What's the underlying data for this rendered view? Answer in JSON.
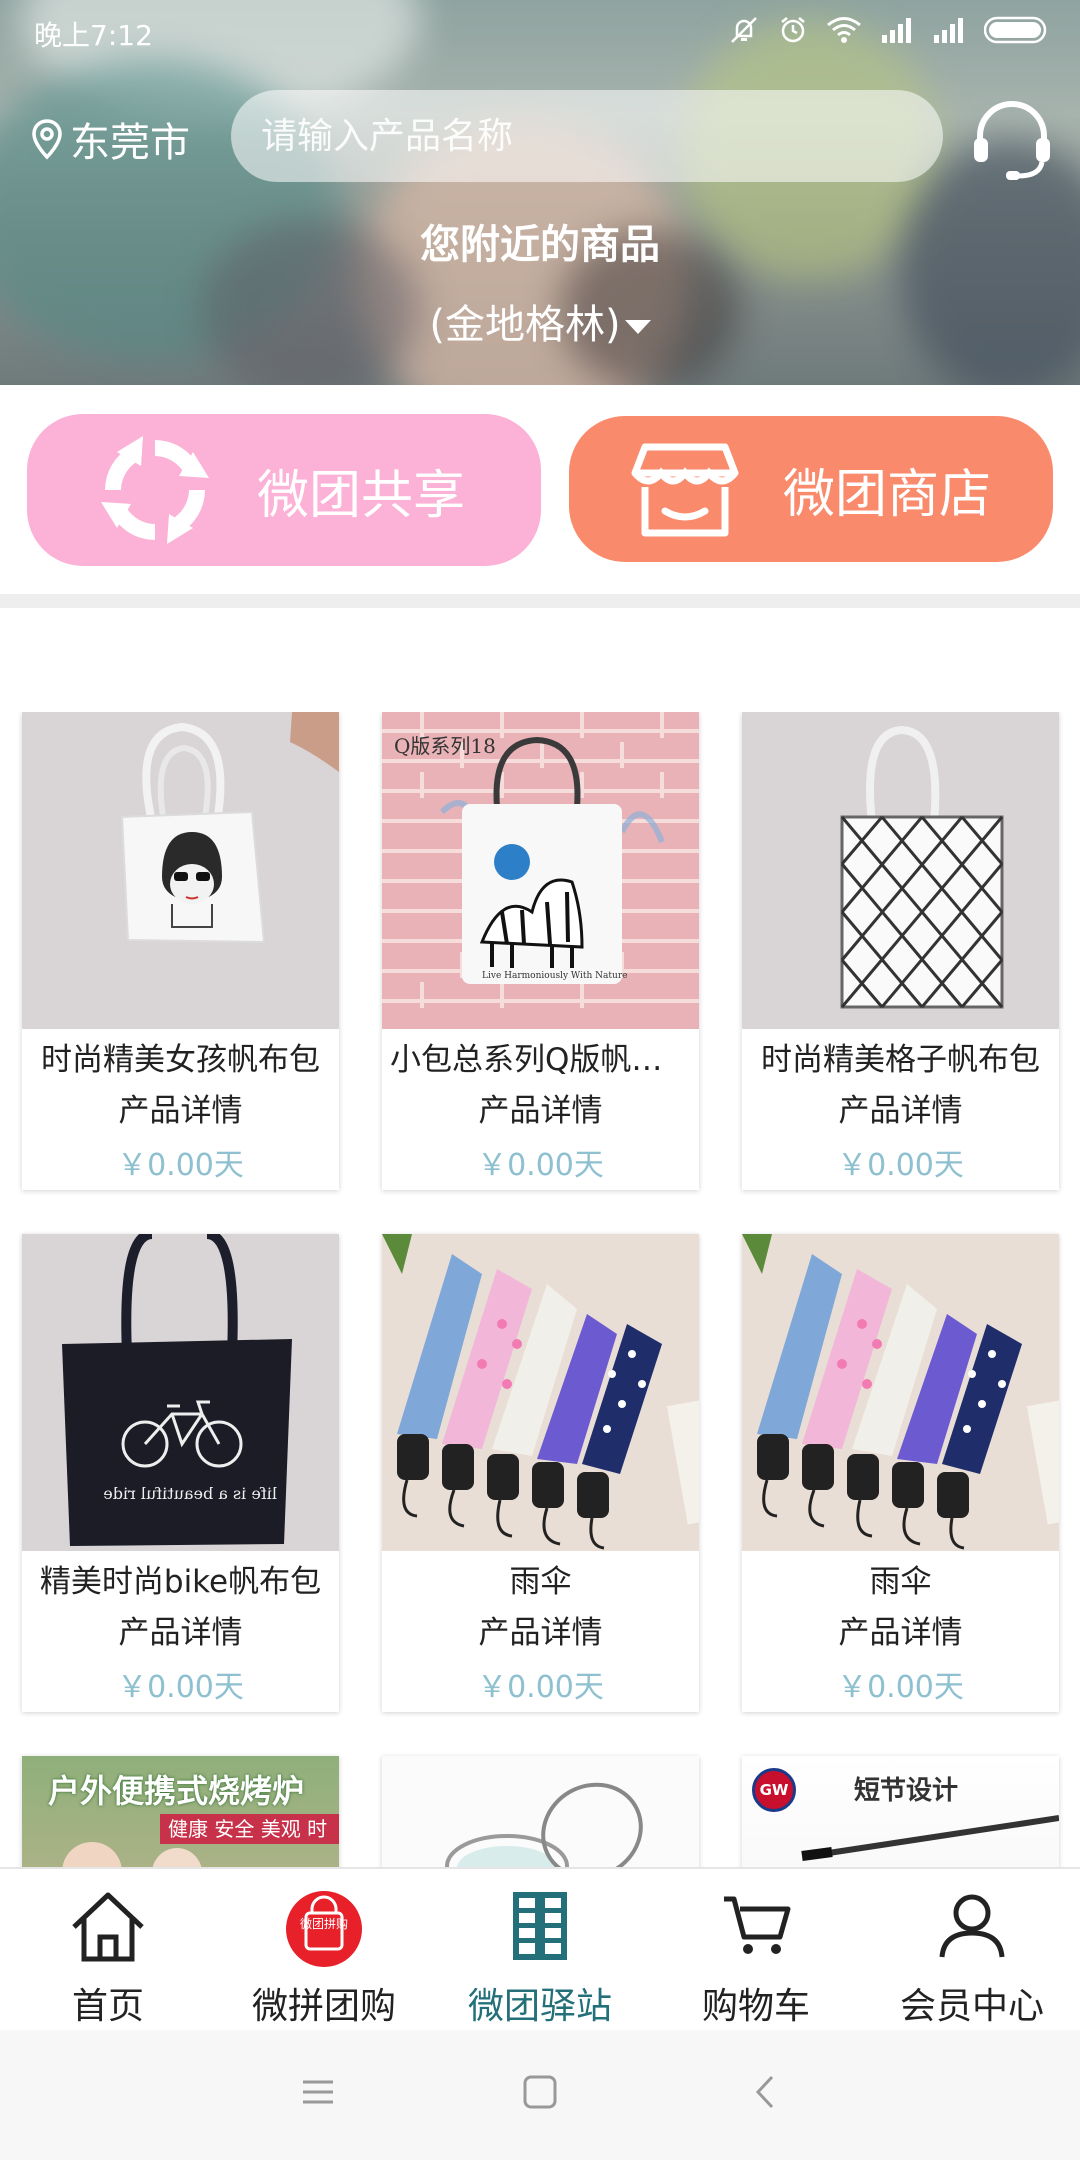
{
  "status": {
    "time": "晚上7:12"
  },
  "header": {
    "location": "东莞市",
    "search_placeholder": "请输入产品名称",
    "title": "您附近的商品",
    "subtitle": "(金地格林)"
  },
  "shortcuts": {
    "share_label": "微团共享",
    "store_label": "微团商店"
  },
  "products": [
    {
      "name": "时尚精美女孩帆布包",
      "detail": "产品详情",
      "price": "￥0.00天",
      "image": "tote-girl"
    },
    {
      "name": "小包总系列Q版帆布包",
      "detail": "产品详情",
      "price": "￥0.00天",
      "image": "tote-zebra",
      "badge": "Q版系列18"
    },
    {
      "name": "时尚精美格子帆布包",
      "detail": "产品详情",
      "price": "￥0.00天",
      "image": "tote-grid"
    },
    {
      "name": "精美时尚bike帆布包",
      "detail": "产品详情",
      "price": "￥0.00天",
      "image": "tote-bike"
    },
    {
      "name": "雨伞",
      "detail": "产品详情",
      "price": "￥0.00天",
      "image": "umbrellas"
    },
    {
      "name": "雨伞",
      "detail": "产品详情",
      "price": "￥0.00天",
      "image": "umbrellas"
    }
  ],
  "partial_row": {
    "bbq_banner": "户外便携式烧烤炉",
    "bbq_tagline": "健康 安全 美观 时尚",
    "gw_logo": "GW",
    "gw_title": "短节设计"
  },
  "tabbar": {
    "items": [
      {
        "label": "首页",
        "icon": "home-icon"
      },
      {
        "label": "微拼团购",
        "icon": "group-buy-icon",
        "badge_text": "微团拼购"
      },
      {
        "label": "微团驿站",
        "icon": "station-icon",
        "active": true
      },
      {
        "label": "购物车",
        "icon": "cart-icon"
      },
      {
        "label": "会员中心",
        "icon": "member-icon"
      }
    ]
  },
  "colors": {
    "share": "#fcb1d6",
    "store": "#fa8a6c",
    "price": "#8ec0d0",
    "active_tab": "#236f7a",
    "group_badge": "#e8202a"
  }
}
